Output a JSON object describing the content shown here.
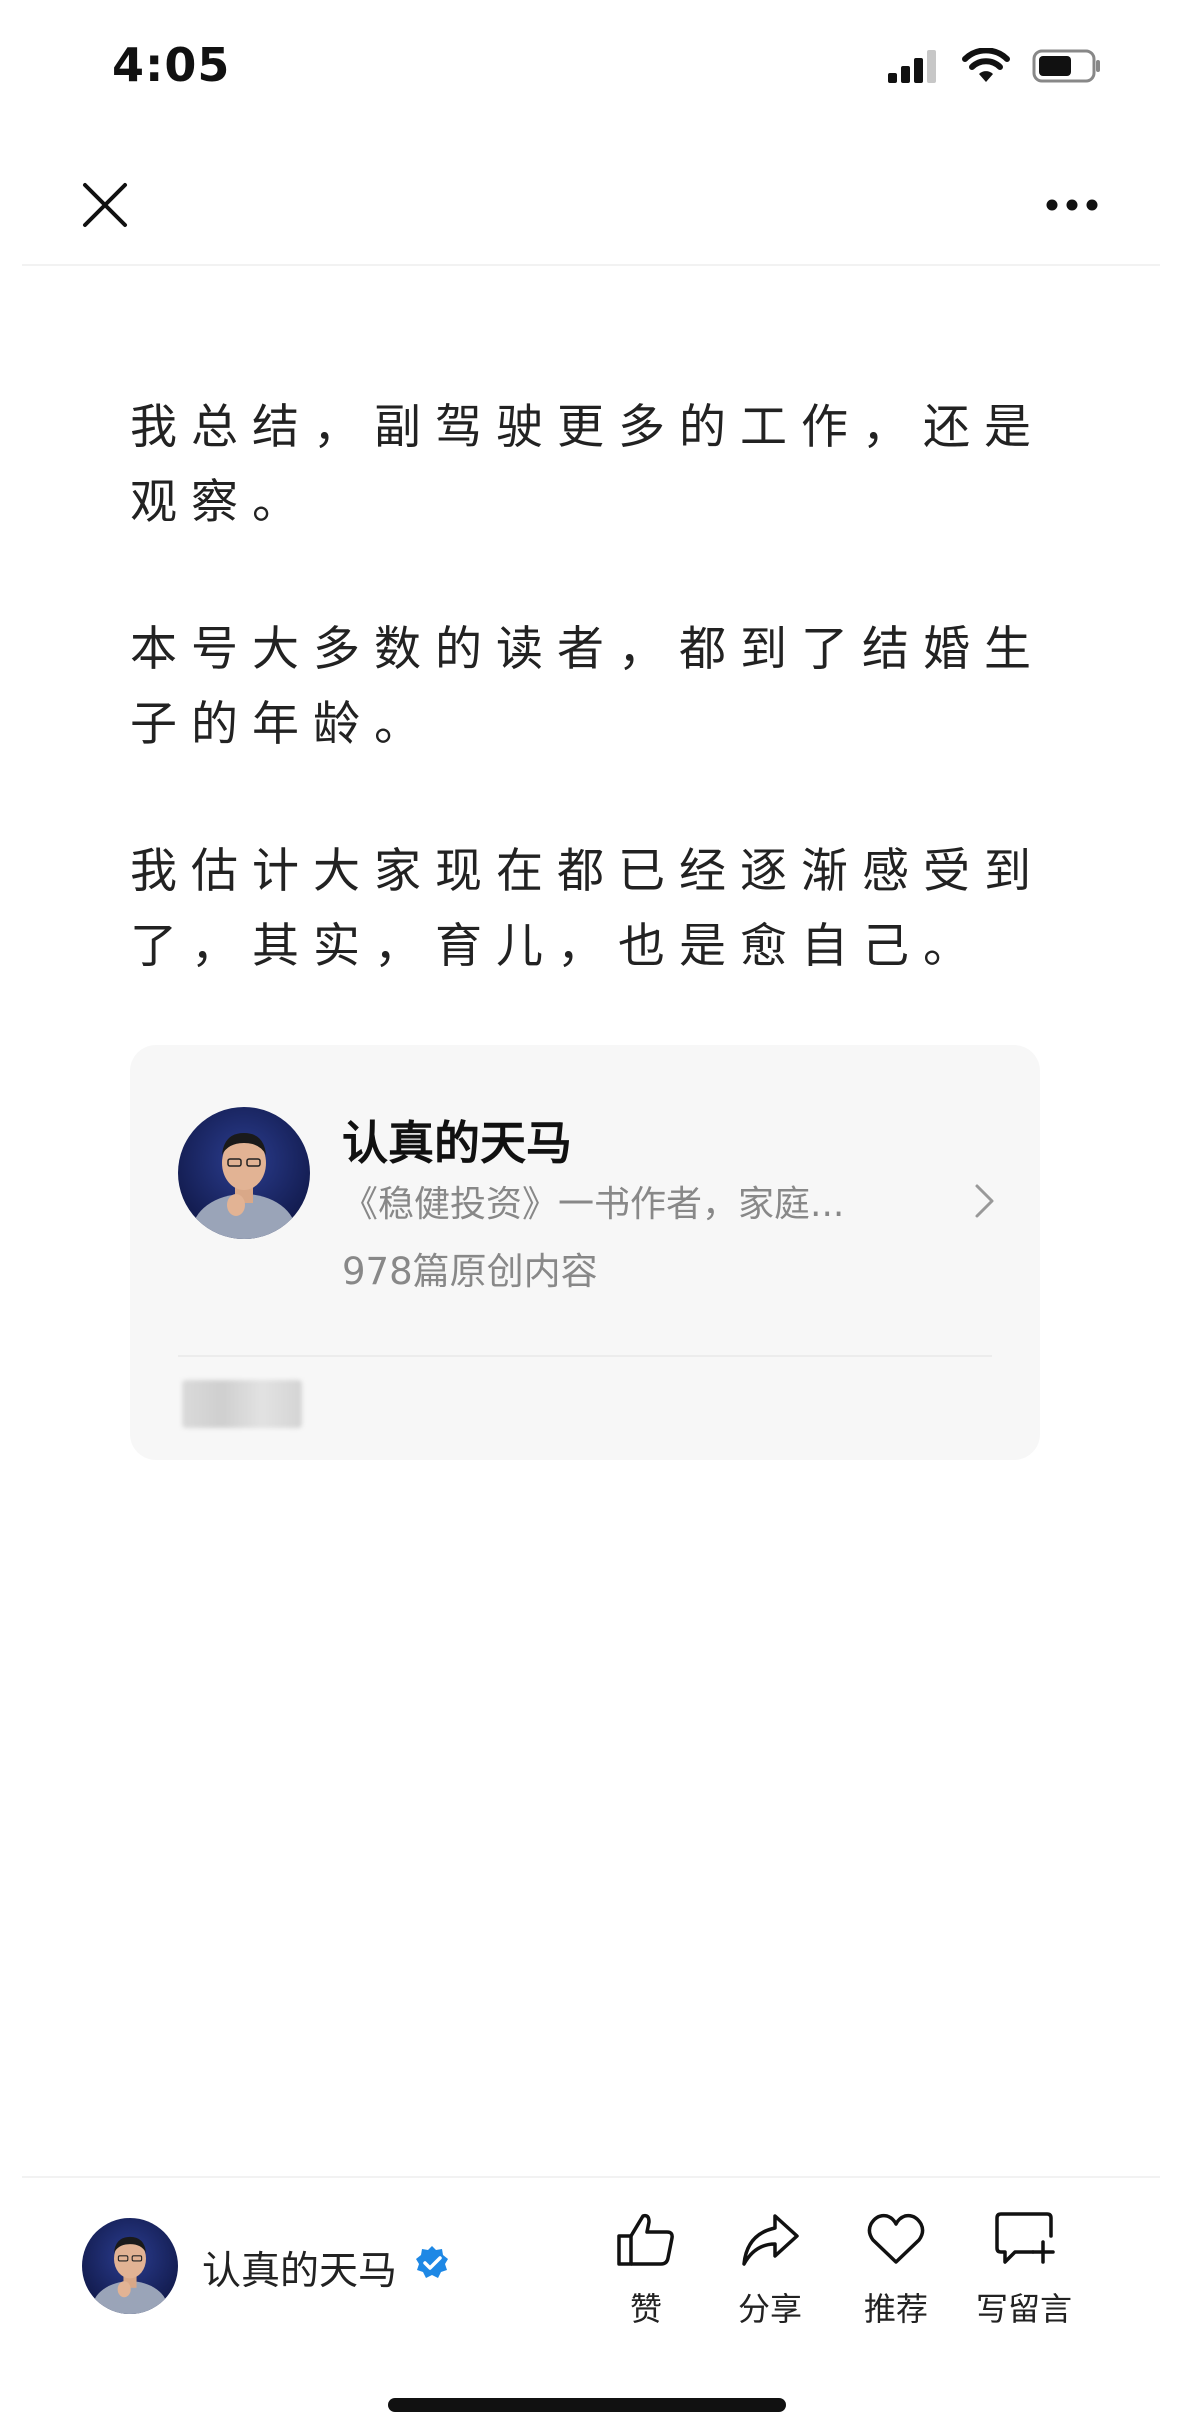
{
  "status_bar": {
    "time": "4:05"
  },
  "nav": {
    "close_icon": "close-icon",
    "more_icon": "more-icon"
  },
  "article": {
    "paragraphs": [
      "我总结，副驾驶更多的工作，还是观察。",
      "本号大多数的读者，都到了结婚生子的年龄。",
      "我估计大家现在都已经逐渐感受到了，其实，育儿，也是愈自己。"
    ]
  },
  "profile_card": {
    "name": "认真的天马",
    "description": "《稳健投资》一书作者，家庭...",
    "article_count": "978篇原创内容"
  },
  "bottom_bar": {
    "author_name": "认真的天马",
    "actions": [
      {
        "label": "赞",
        "icon": "thumbs-up-icon"
      },
      {
        "label": "分享",
        "icon": "share-icon"
      },
      {
        "label": "推荐",
        "icon": "heart-icon"
      },
      {
        "label": "写留言",
        "icon": "comment-add-icon"
      }
    ]
  },
  "colors": {
    "text": "#222222",
    "muted": "#888888",
    "card_bg": "#f7f7f7",
    "verified": "#1e88e5"
  }
}
